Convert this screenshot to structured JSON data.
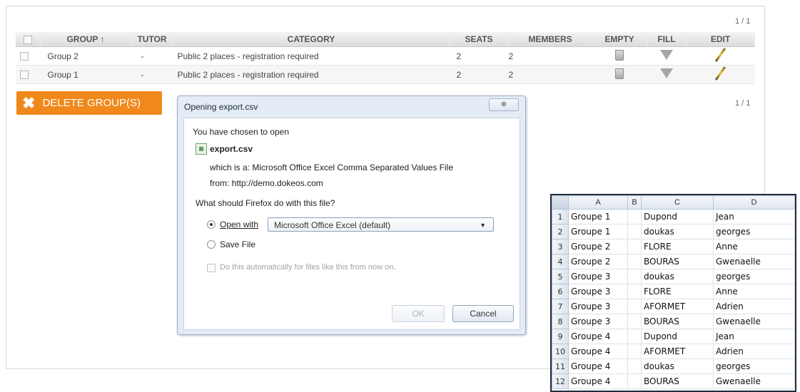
{
  "pager": {
    "top": "1 / 1",
    "bottom": "1 / 1"
  },
  "table": {
    "columns": [
      "GROUP ↑",
      "TUTOR",
      "CATEGORY",
      "SEATS",
      "MEMBERS",
      "EMPTY",
      "FILL",
      "EDIT"
    ],
    "rows": [
      {
        "group": "Group 2",
        "tutor": "-",
        "category": "Public 2 places - registration required",
        "seats": "2",
        "members": "2"
      },
      {
        "group": "Group 1",
        "tutor": "-",
        "category": "Public 2 places - registration required",
        "seats": "2",
        "members": "2"
      }
    ]
  },
  "delete_button": {
    "icon": "x-icon",
    "label": "DELETE GROUP(S)",
    "color": "#f1881b"
  },
  "dialog": {
    "title": "Opening export.csv",
    "close": "⊗",
    "chosen": "You have chosen to open",
    "filename": "export.csv",
    "which_is": "which is a:  Microsoft Office Excel Comma Separated Values File",
    "from": "from:  http://demo.dokeos.com",
    "question": "What should Firefox do with this file?",
    "open_with_label": "Open with",
    "open_with_value": "Microsoft Office Excel (default)",
    "save_file_label": "Save File",
    "auto_label": "Do this automatically for files like this from now on.",
    "ok_label": "OK",
    "cancel_label": "Cancel"
  },
  "spreadsheet": {
    "columns": [
      "A",
      "B",
      "C",
      "D"
    ],
    "rows": [
      [
        "1",
        "Groupe 1",
        "",
        "Dupond",
        "Jean"
      ],
      [
        "2",
        "Groupe 1",
        "",
        "doukas",
        "georges"
      ],
      [
        "3",
        "Groupe 2",
        "",
        "FLORE",
        "Anne"
      ],
      [
        "4",
        "Groupe 2",
        "",
        "BOURAS",
        "Gwenaelle"
      ],
      [
        "5",
        "Groupe 3",
        "",
        "doukas",
        "georges"
      ],
      [
        "6",
        "Groupe 3",
        "",
        "FLORE",
        "Anne"
      ],
      [
        "7",
        "Groupe 3",
        "",
        "AFORMET",
        "Adrien"
      ],
      [
        "8",
        "Groupe 3",
        "",
        "BOURAS",
        "Gwenaelle"
      ],
      [
        "9",
        "Groupe 4",
        "",
        "Dupond",
        "Jean"
      ],
      [
        "10",
        "Groupe 4",
        "",
        "AFORMET",
        "Adrien"
      ],
      [
        "11",
        "Groupe 4",
        "",
        "doukas",
        "georges"
      ],
      [
        "12",
        "Groupe 4",
        "",
        "BOURAS",
        "Gwenaelle"
      ]
    ]
  }
}
